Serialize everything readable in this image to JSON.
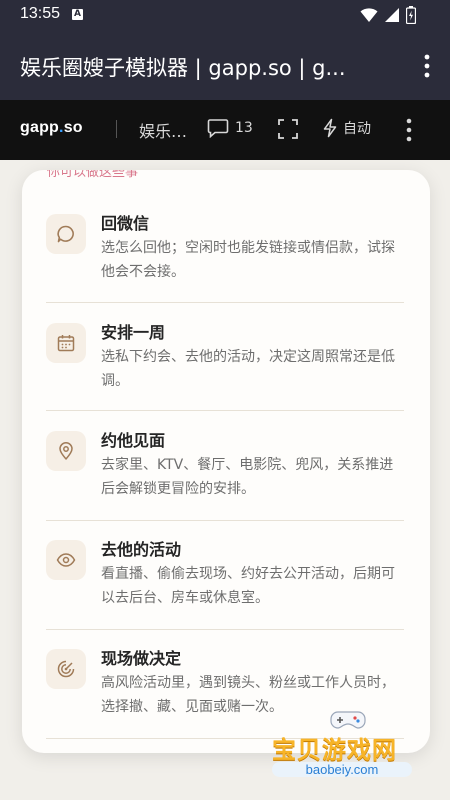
{
  "status_bar": {
    "time": "13:55",
    "notification_icon": "A"
  },
  "app_bar": {
    "title": "娱乐圈嫂子模拟器 | gapp.so | g..."
  },
  "toolbar": {
    "brand_left": "gapp",
    "brand_dot": ".",
    "brand_right": "so",
    "game_title": "娱乐…",
    "comment_count": "13",
    "auto_label": "自动"
  },
  "section_heading": "你可以做这些事",
  "items": [
    {
      "title": "回微信",
      "desc": "选怎么回他；空闲时也能发链接或情侣款，试探他会不会接。",
      "icon": "chat-bubble-icon"
    },
    {
      "title": "安排一周",
      "desc": "选私下约会、去他的活动，决定这周照常还是低调。",
      "icon": "calendar-icon"
    },
    {
      "title": "约他见面",
      "desc": "去家里、KTV、餐厅、电影院、兜风，关系推进后会解锁更冒险的安排。",
      "icon": "location-pin-icon"
    },
    {
      "title": "去他的活动",
      "desc": "看直播、偷偷去现场、约好去公开活动，后期可以去后台、房车或休息室。",
      "icon": "eye-icon"
    },
    {
      "title": "现场做决定",
      "desc": "高风险活动里，遇到镜头、粉丝或工作人员时，选择撤、藏、见面或赌一次。",
      "icon": "radar-icon"
    }
  ],
  "watermark": {
    "text": "宝贝游戏网",
    "url": "baobeiy.com"
  },
  "colors": {
    "accent_blue": "#3aa0ff",
    "header_bg": "#2b2c3a",
    "toolbar_bg": "#111111",
    "icon_bg": "#f6efe6",
    "icon_stroke": "#a07b58"
  }
}
